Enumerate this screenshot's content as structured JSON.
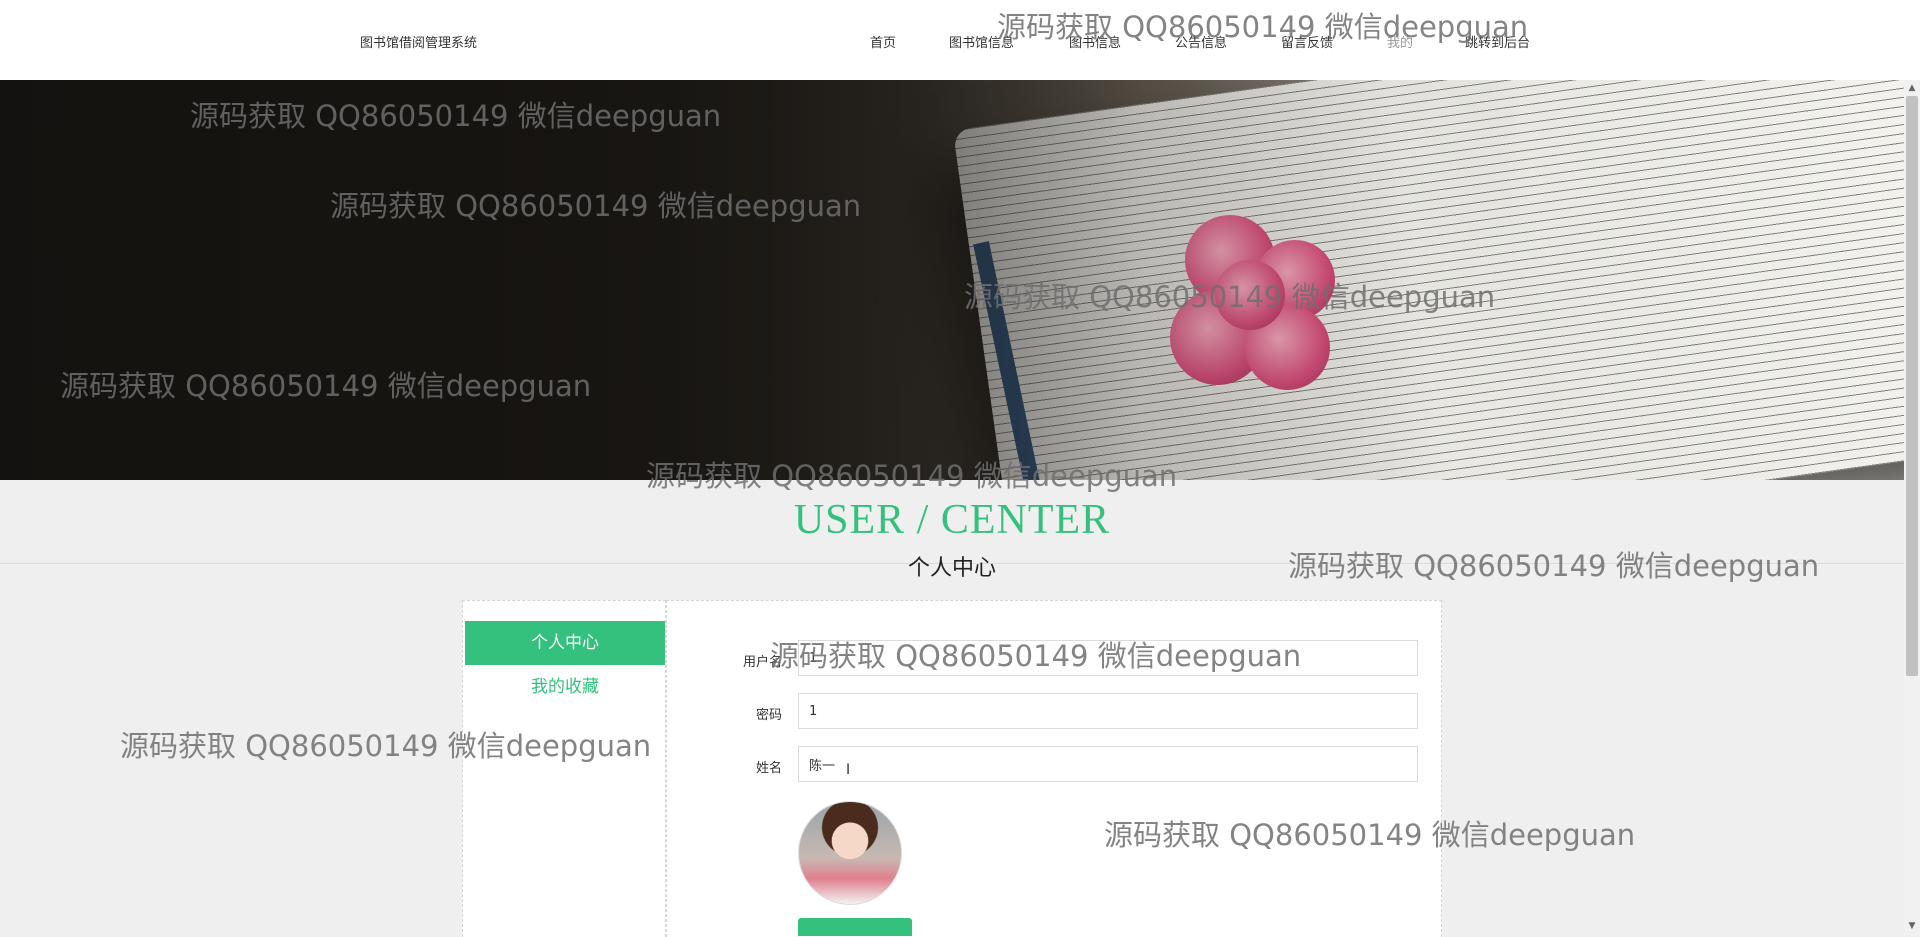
{
  "header": {
    "site_title": "图书馆借阅管理系统",
    "nav": [
      {
        "label": "首页"
      },
      {
        "label": "图书馆信息"
      },
      {
        "label": "图书信息"
      },
      {
        "label": "公告信息"
      },
      {
        "label": "留言反馈"
      },
      {
        "label": "我的"
      },
      {
        "label": "跳转到后台"
      }
    ]
  },
  "section": {
    "title_en": "USER / CENTER",
    "title_cn": "个人中心"
  },
  "sidebar": {
    "items": [
      {
        "label": "个人中心"
      },
      {
        "label": "我的收藏"
      }
    ]
  },
  "form": {
    "username_label": "用户名",
    "username_value": "1",
    "password_label": "密码",
    "password_value": "1",
    "name_label": "姓名",
    "name_value": "陈一"
  },
  "watermark": "源码获取 QQ86050149 微信deepguan",
  "colors": {
    "accent": "#34c17d"
  }
}
